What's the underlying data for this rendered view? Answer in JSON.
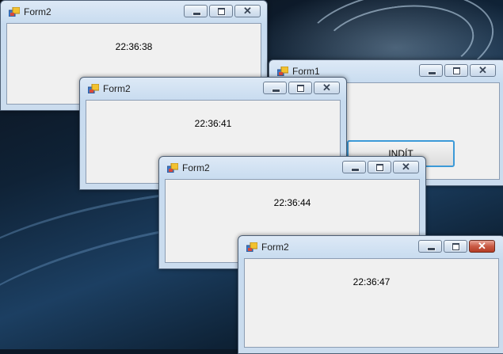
{
  "form1": {
    "title": "Form1",
    "button_label": "INDÍT"
  },
  "forms2": [
    {
      "title": "Form2",
      "time": "22:36:38"
    },
    {
      "title": "Form2",
      "time": "22:36:41"
    },
    {
      "title": "Form2",
      "time": "22:36:44"
    },
    {
      "title": "Form2",
      "time": "22:36:47"
    }
  ],
  "colors": {
    "close_active": "#c95a44",
    "button_focus_border": "#3c9ad8",
    "client_background": "#f0f0f0"
  },
  "icons": {
    "app": "form-app-icon",
    "minimize": "minimize-icon",
    "maximize": "maximize-icon",
    "close": "close-icon"
  }
}
